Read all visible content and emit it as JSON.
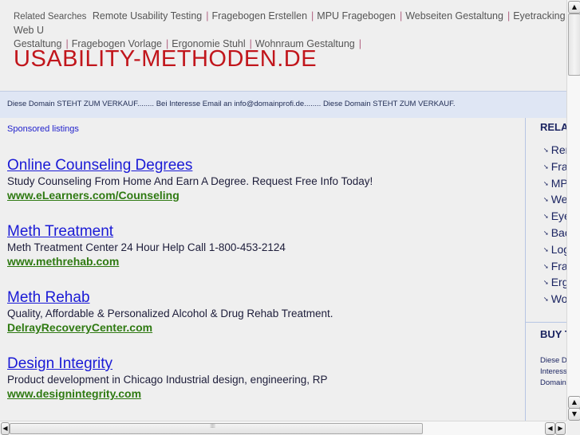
{
  "related_searches": {
    "label": "Related Searches",
    "items": [
      "Remote Usability Testing",
      "Fragebogen Erstellen",
      "MPU Fragebogen",
      "Webseiten Gestaltung",
      "Eyetracking Web Usability",
      "Fragebogen Vorlage",
      "Ergonomie Stuhl",
      "Wohnraum Gestaltung"
    ],
    "line1_last_visible": "Eyetracking Web U",
    "line2_first": "Gestaltung",
    "separator": "|"
  },
  "site_title": "USABILITY-METHODEN.DE",
  "sale_banner": "Diese Domain STEHT ZUM VERKAUF........ Bei Interesse Email an info@domainprofi.de........ Diese Domain STEHT ZUM VERKAUF.",
  "sponsored_label": "Sponsored listings",
  "listings": [
    {
      "title": "Online Counseling Degrees",
      "description": "Study Counseling From Home And Earn A Degree. Request Free Info Today!",
      "url": "www.eLearners.com/Counseling"
    },
    {
      "title": "Meth Treatment",
      "description": "Meth Treatment Center 24 Hour Help Call 1-800-453-2124",
      "url": "www.methrehab.com"
    },
    {
      "title": "Meth Rehab",
      "description": "Quality, Affordable & Personalized Alcohol & Drug Rehab Treatment.",
      "url": "DelrayRecoveryCenter.com"
    },
    {
      "title": "Design Integrity",
      "description": "Product development in Chicago Industrial design, engineering, RP",
      "url": "www.designintegrity.com"
    }
  ],
  "sidebar": {
    "heading": "RELATED SEARCHES",
    "items": [
      "Remote Usability Testing",
      "Fragebogen Erstellen",
      "MPU Fragebogen",
      "Webseiten Gestaltung",
      "Eyetracking Web Usability",
      "Backup",
      "Logo",
      "Fragebogen Vorlage",
      "Ergonomie Stuhl",
      "Wohnraum Gestaltung"
    ],
    "buy_heading": "BUY THIS DOMAIN",
    "buy_text": "Diese Domain\nInteresse\nDomain"
  },
  "scrollbar": {
    "up_icon": "▲",
    "down_icon": "▼",
    "left_icon": "◀",
    "right_icon": "▶"
  },
  "colors": {
    "title_red": "#c1161c",
    "link_blue": "#1a1ad6",
    "url_green": "#2f7a12",
    "banner_bg": "#dfe6f4",
    "sidebar_navy": "#1b2461"
  }
}
